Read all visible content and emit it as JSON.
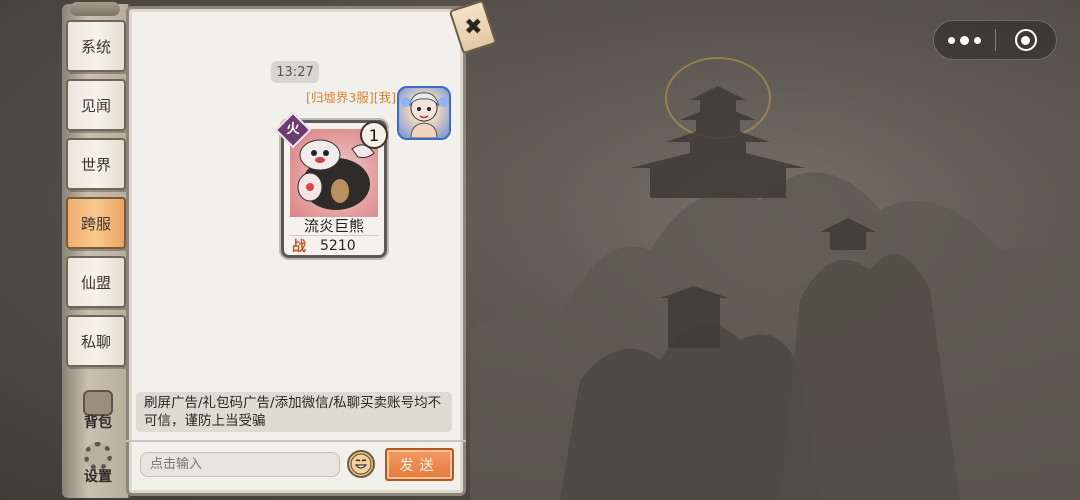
{
  "tabs": [
    {
      "label": "系统",
      "active": false
    },
    {
      "label": "见闻",
      "active": false
    },
    {
      "label": "世界",
      "active": false
    },
    {
      "label": "跨服",
      "active": true
    },
    {
      "label": "仙盟",
      "active": false
    },
    {
      "label": "私聊",
      "active": false
    }
  ],
  "tools": {
    "bag_label": "背包",
    "settings_label": "设置"
  },
  "chat": {
    "timestamp": "13:27",
    "sender": "[归墟界3服][我]",
    "card": {
      "element": "火",
      "level": "1",
      "name": "流炎巨熊",
      "power_label": "战",
      "power": "5210"
    },
    "warning": "刷屏广告/礼包码广告/添加微信/私聊买卖账号均不可信，谨防上当受骗"
  },
  "input": {
    "placeholder": "点击输入",
    "send_label": "发送"
  },
  "colors": {
    "accent": "#e57b3c",
    "sender": "#d6843a",
    "active_tab": "#f8c98f"
  },
  "icons": {
    "close": "close-icon",
    "emoji": "emoji-icon",
    "more": "more-dots-icon",
    "target": "target-icon"
  }
}
